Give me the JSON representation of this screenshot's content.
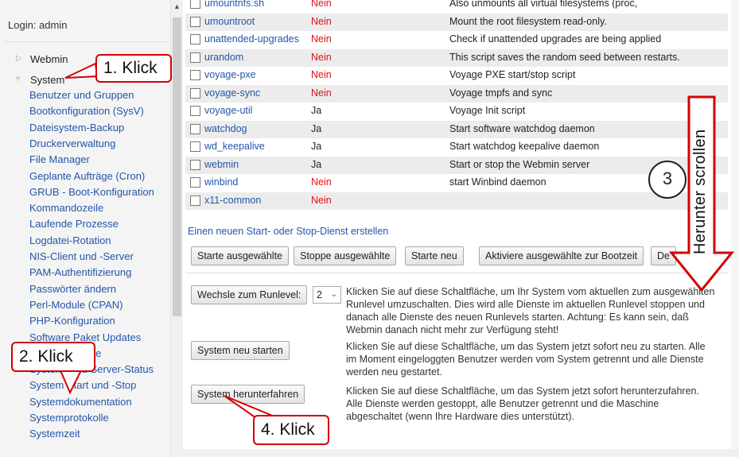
{
  "sidebar": {
    "login": "Login: admin",
    "categories": [
      {
        "label": "Webmin"
      },
      {
        "label": "System"
      }
    ],
    "system_items": [
      "Benutzer und Gruppen",
      "Bootkonfiguration (SysV)",
      "Dateisystem-Backup",
      "Druckerverwaltung",
      "File Manager",
      "Geplante Aufträge (Cron)",
      "GRUB - Boot-Konfiguration",
      "Kommandozeile",
      "Laufende Prozesse",
      "Logdatei-Rotation",
      "NIS-Client und -Server",
      "PAM-Authentifizierung",
      "Passwörter ändern",
      "Perl-Module (CPAN)",
      "PHP-Konfiguration",
      "Software Paket Updates",
      "Softwarepakete",
      "System- und Server-Status",
      "System Start und -Stop",
      "Systemdokumentation",
      "Systemprotokolle",
      "Systemzeit"
    ]
  },
  "services": [
    {
      "name": "umountnfs.sh",
      "boot": "Nein",
      "desc": "Also unmounts all virtual filesystems (proc,"
    },
    {
      "name": "umountroot",
      "boot": "Nein",
      "desc": "Mount the root filesystem read-only."
    },
    {
      "name": "unattended-upgrades",
      "boot": "Nein",
      "desc": "Check if unattended upgrades are being applied"
    },
    {
      "name": "urandom",
      "boot": "Nein",
      "desc": "This script saves the random seed between restarts."
    },
    {
      "name": "voyage-pxe",
      "boot": "Nein",
      "desc": "Voyage PXE start/stop script"
    },
    {
      "name": "voyage-sync",
      "boot": "Nein",
      "desc": "Voyage tmpfs and sync"
    },
    {
      "name": "voyage-util",
      "boot": "Ja",
      "desc": "Voyage Init script"
    },
    {
      "name": "watchdog",
      "boot": "Ja",
      "desc": "Start software watchdog daemon"
    },
    {
      "name": "wd_keepalive",
      "boot": "Ja",
      "desc": "Start watchdog keepalive daemon"
    },
    {
      "name": "webmin",
      "boot": "Ja",
      "desc": "Start or stop the Webmin server"
    },
    {
      "name": "winbind",
      "boot": "Nein",
      "desc": "start Winbind daemon"
    },
    {
      "name": "x11-common",
      "boot": "Nein",
      "desc": ""
    }
  ],
  "create_link": "Einen neuen Start- oder Stop-Dienst erstellen",
  "action_buttons": {
    "start_selected": "Starte ausgewählte",
    "stop_selected": "Stoppe ausgewählte",
    "restart": "Starte neu",
    "activate_boot": "Aktiviere ausgewählte zur Bootzeit",
    "deactivate": "De"
  },
  "runlevel": {
    "button": "Wechsle zum Runlevel:",
    "selected": "2",
    "text1": "Klicken Sie auf diese Schaltfläche, um Ihr System vom aktuellen zum ausgewählten",
    "text2": "Runlevel umzuschalten. Dies wird alle Dienste im aktuellen Runlevel stoppen und",
    "text3": "danach alle Dienste des neuen Runlevels starten. Achtung: Es kann sein, daß",
    "text4": "Webmin danach nicht mehr zur Verfügung steht!"
  },
  "reboot": {
    "button": "System neu starten",
    "text1": "Klicken Sie auf diese Schaltfläche, um das System jetzt sofort neu zu starten. Alle",
    "text2": "im Moment eingeloggten Benutzer werden vom System getrennt und alle Dienste",
    "text3": "werden neu gestartet."
  },
  "shutdown": {
    "button": "System herunterfahren",
    "text1": "Klicken Sie auf diese Schaltfläche, um das System jetzt sofort herunterzufahren.",
    "text2": "Alle Dienste werden gestoppt, alle Benutzer getrennt und die Maschine",
    "text3": "abgeschaltet (wenn Ihre Hardware dies unterstützt)."
  },
  "annotations": {
    "klick1": "1. Klick",
    "klick2": "2. Klick",
    "circle3": "3",
    "scroll": "Herunter scrollen",
    "klick4": "4. Klick",
    "color": "#d40000"
  }
}
